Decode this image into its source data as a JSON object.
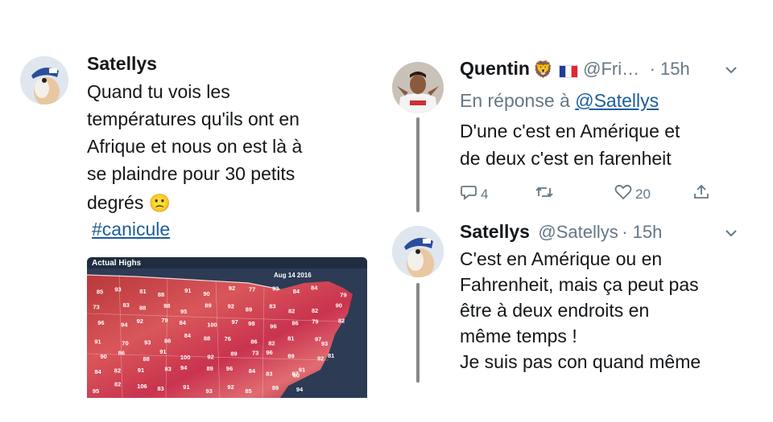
{
  "left_tweet": {
    "author": "Satellys",
    "text_lines": [
      "Quand tu vois les",
      "températures qu'ils ont en",
      "Afrique et nous on est là à",
      "se plaindre pour 30 petits",
      "degrés"
    ],
    "emoji": "🙁",
    "hashtag": "#canicule",
    "map": {
      "title": "Actual Highs",
      "date": "Aug 14 2016",
      "temperatures": [
        "85",
        "93",
        "81",
        "88",
        "91",
        "90",
        "92",
        "77",
        "93",
        "84",
        "84",
        "79",
        "73",
        "83",
        "88",
        "98",
        "95",
        "89",
        "92",
        "89",
        "83",
        "82",
        "82",
        "90",
        "96",
        "94",
        "92",
        "79",
        "84",
        "100",
        "97",
        "98",
        "96",
        "86",
        "79",
        "82",
        "91",
        "70",
        "93",
        "86",
        "84",
        "88",
        "76",
        "86",
        "82",
        "81",
        "97",
        "93",
        "90",
        "86",
        "88",
        "91",
        "100",
        "92",
        "89",
        "73",
        "96",
        "89",
        "92",
        "81",
        "84",
        "82",
        "91",
        "83",
        "94",
        "89",
        "96",
        "84",
        "83",
        "87",
        "80",
        "91",
        "95",
        "82",
        "106",
        "83",
        "91",
        "93",
        "92",
        "85",
        "89",
        "94"
      ]
    }
  },
  "reply1": {
    "author": "Quentin",
    "author_emoji": "🦁",
    "flag_colors": [
      "#1f3e9c",
      "#ffffff",
      "#e4262f"
    ],
    "handle": "@Fri…",
    "time": "· 15h",
    "reply_prefix": "En réponse à ",
    "reply_to": "@Satellys",
    "text_lines": [
      "D'une c'est en Amérique et",
      "de deux c'est en farenheit"
    ],
    "replies": "4",
    "likes": "20"
  },
  "reply2": {
    "author": "Satellys",
    "handle": "@Satellys",
    "time": "· 15h",
    "text_lines": [
      "C'est en Amérique ou en",
      "Fahrenheit, mais ça peut pas",
      "être à deux endroits en",
      "même temps !",
      "Je suis pas con quand même"
    ]
  }
}
